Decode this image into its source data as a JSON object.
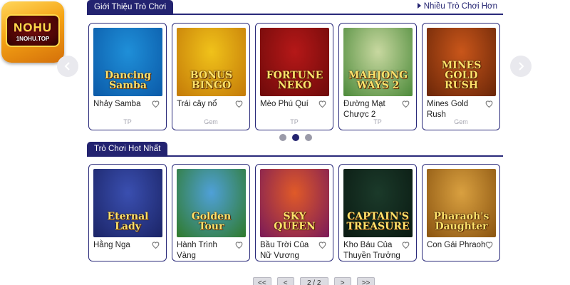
{
  "logo": {
    "title": "NOHU",
    "subtitle": "1NOHU.TOP"
  },
  "intro_section": {
    "title": "Giới Thiệu Trò Chơi",
    "more_link": "Nhiều Trò Chơi Hơn",
    "games": [
      {
        "name": "Nhảy Samba",
        "provider": "TP",
        "thumb_text": "Dancing Samba",
        "colors": [
          "#1f8fd8",
          "#0b5aa8"
        ]
      },
      {
        "name": "Trái cây nổ",
        "provider": "Gem",
        "thumb_text": "BONUS BINGO",
        "colors": [
          "#f0c21a",
          "#c47a08"
        ]
      },
      {
        "name": "Mèo Phú Quí",
        "provider": "TP",
        "thumb_text": "FORTUNE NEKO",
        "colors": [
          "#b51818",
          "#6e0a0a"
        ]
      },
      {
        "name": "Đường Mạt Chược 2",
        "provider": "TP",
        "thumb_text": "MAHJONG WAYS 2",
        "colors": [
          "#c8d8a0",
          "#4c8a3a"
        ]
      },
      {
        "name": "Mines Gold Rush",
        "provider": "Gem",
        "thumb_text": "MINES GOLD RUSH",
        "colors": [
          "#c9561a",
          "#6a2608"
        ]
      }
    ],
    "carousel_dots": 3,
    "active_dot": 1
  },
  "hot_section": {
    "title": "Trò Chơi Hot Nhất",
    "games": [
      {
        "name": "Hằng Nga",
        "thumb_text": "Eternal Lady",
        "colors": [
          "#3a4fb0",
          "#1b2466"
        ]
      },
      {
        "name": "Hành Trình Vàng",
        "thumb_text": "Golden Tour",
        "colors": [
          "#4fa0d8",
          "#2f7a2a"
        ]
      },
      {
        "name": "Bầu Trời Của Nữ Vương",
        "thumb_text": "SKY QUEEN",
        "colors": [
          "#e05a28",
          "#7a1a58"
        ]
      },
      {
        "name": "Kho Báu Của Thuyền Trưởng",
        "thumb_text": "CAPTAIN'S TREASURE",
        "colors": [
          "#1b3a2a",
          "#0a1a12"
        ]
      },
      {
        "name": "Con Gái Phraoh",
        "thumb_text": "Pharaoh's Daughter",
        "colors": [
          "#d9a040",
          "#8a5410"
        ]
      }
    ]
  },
  "pagination": {
    "first": "<<",
    "prev": "<",
    "current": "2 / 2",
    "next": ">",
    "last": ">>"
  },
  "icons": {
    "prev": "chevron-left-icon",
    "next": "chevron-right-icon",
    "favorite": "heart-icon"
  }
}
